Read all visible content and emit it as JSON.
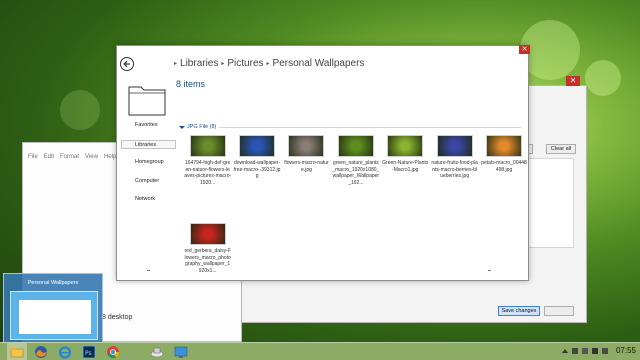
{
  "explorer": {
    "breadcrumb": [
      "Libraries",
      "Pictures",
      "Personal Wallpapers"
    ],
    "item_count": "8 items",
    "group_label": "JPG File (8)",
    "nav": [
      "Favorites",
      "Libraries",
      "Homegroup",
      "Computer",
      "Network"
    ],
    "close_label": "✕",
    "files": [
      {
        "name": "164794-high-def-green-nature-flowers-leaves-pictures-macro-1920...",
        "color": "#6c8f2c"
      },
      {
        "name": "download-wallpaper-free-macro--39312.jpg",
        "color": "#2b56b8"
      },
      {
        "name": "flowers-macro-nature.jpg",
        "color": "#8a7d76"
      },
      {
        "name": "green_nature_plants_macro_1920x1080_wallpaper_Wallpaper_192...",
        "color": "#5e8f1e"
      },
      {
        "name": "Green-Nature-Plants-Macro1.jpg",
        "color": "#8bb42f"
      },
      {
        "name": "nature-fruits-food-plants-macro-berries-blueberries.jpg",
        "color": "#3a46a6"
      },
      {
        "name": "petals-macro_00448498.jpg",
        "color": "#e48a2c"
      },
      {
        "name": "red_gerbera_daisy-Flowers_macro_photography_wallpaper_1920x1...",
        "color": "#c8231e"
      }
    ]
  },
  "notepad": {
    "menu": [
      "File",
      "Edit",
      "Format",
      "View",
      "Help"
    ],
    "desktop_label": "8 desktop"
  },
  "settings": {
    "clear_all_label": "Clear all",
    "save_label": "Save changes",
    "close_label": "✕"
  },
  "preview": {
    "title": "Personal Wallpapers"
  },
  "taskbar": {
    "clock": "07:55",
    "apps": [
      "file-explorer",
      "firefox",
      "internet-explorer",
      "photoshop",
      "chrome",
      "network-tool",
      "remote-desktop"
    ]
  },
  "colors": {
    "accent": "#1c4e80",
    "close_red": "#c6322b",
    "save_blue": "#3d7fd9"
  }
}
